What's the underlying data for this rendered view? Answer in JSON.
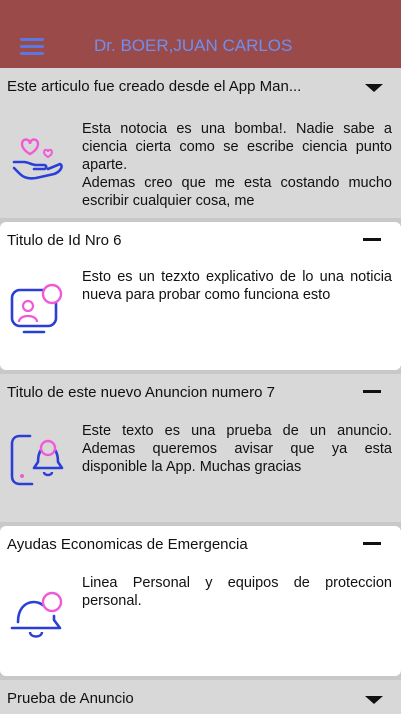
{
  "appbar": {
    "title": "Dr. BOER,JUAN CARLOS",
    "menu_icon": "hamburger-menu-icon"
  },
  "cards": [
    {
      "title": "Este articulo fue creado desde el App Man...",
      "toggle": "caret-down",
      "icon": "heart-hand-icon",
      "body": [
        "Esta notocia es una bomba!. Nadie sabe a ciencia cierta como se escribe ciencia punto aparte.",
        "Ademas creo que me esta costando mucho escribir cualquier cosa, me"
      ]
    },
    {
      "title": "Titulo de Id Nro 6",
      "toggle": "minus",
      "icon": "user-monitor-icon",
      "body": [
        "Esto es un tezxto explicativo de lo una noticia nueva para probar como funciona esto"
      ]
    },
    {
      "title": "Titulo de este nuevo Anuncion numero 7",
      "toggle": "minus",
      "icon": "device-bell-icon",
      "body": [
        "Este texto es una prueba de un anuncio. Ademas queremos avisar que ya esta disponible la App. Muchas gracias"
      ]
    },
    {
      "title": "Ayudas Economicas de Emergencia",
      "toggle": "minus",
      "icon": "bell-badge-icon",
      "body": [
        "Linea Personal y equipos de proteccion personal."
      ]
    },
    {
      "title": "Prueba de Anuncio",
      "toggle": "caret-down"
    }
  ],
  "colors": {
    "appbar": "#9b4a4a",
    "accent_blue": "#2a3fd6",
    "accent_pink": "#f05ad8"
  }
}
